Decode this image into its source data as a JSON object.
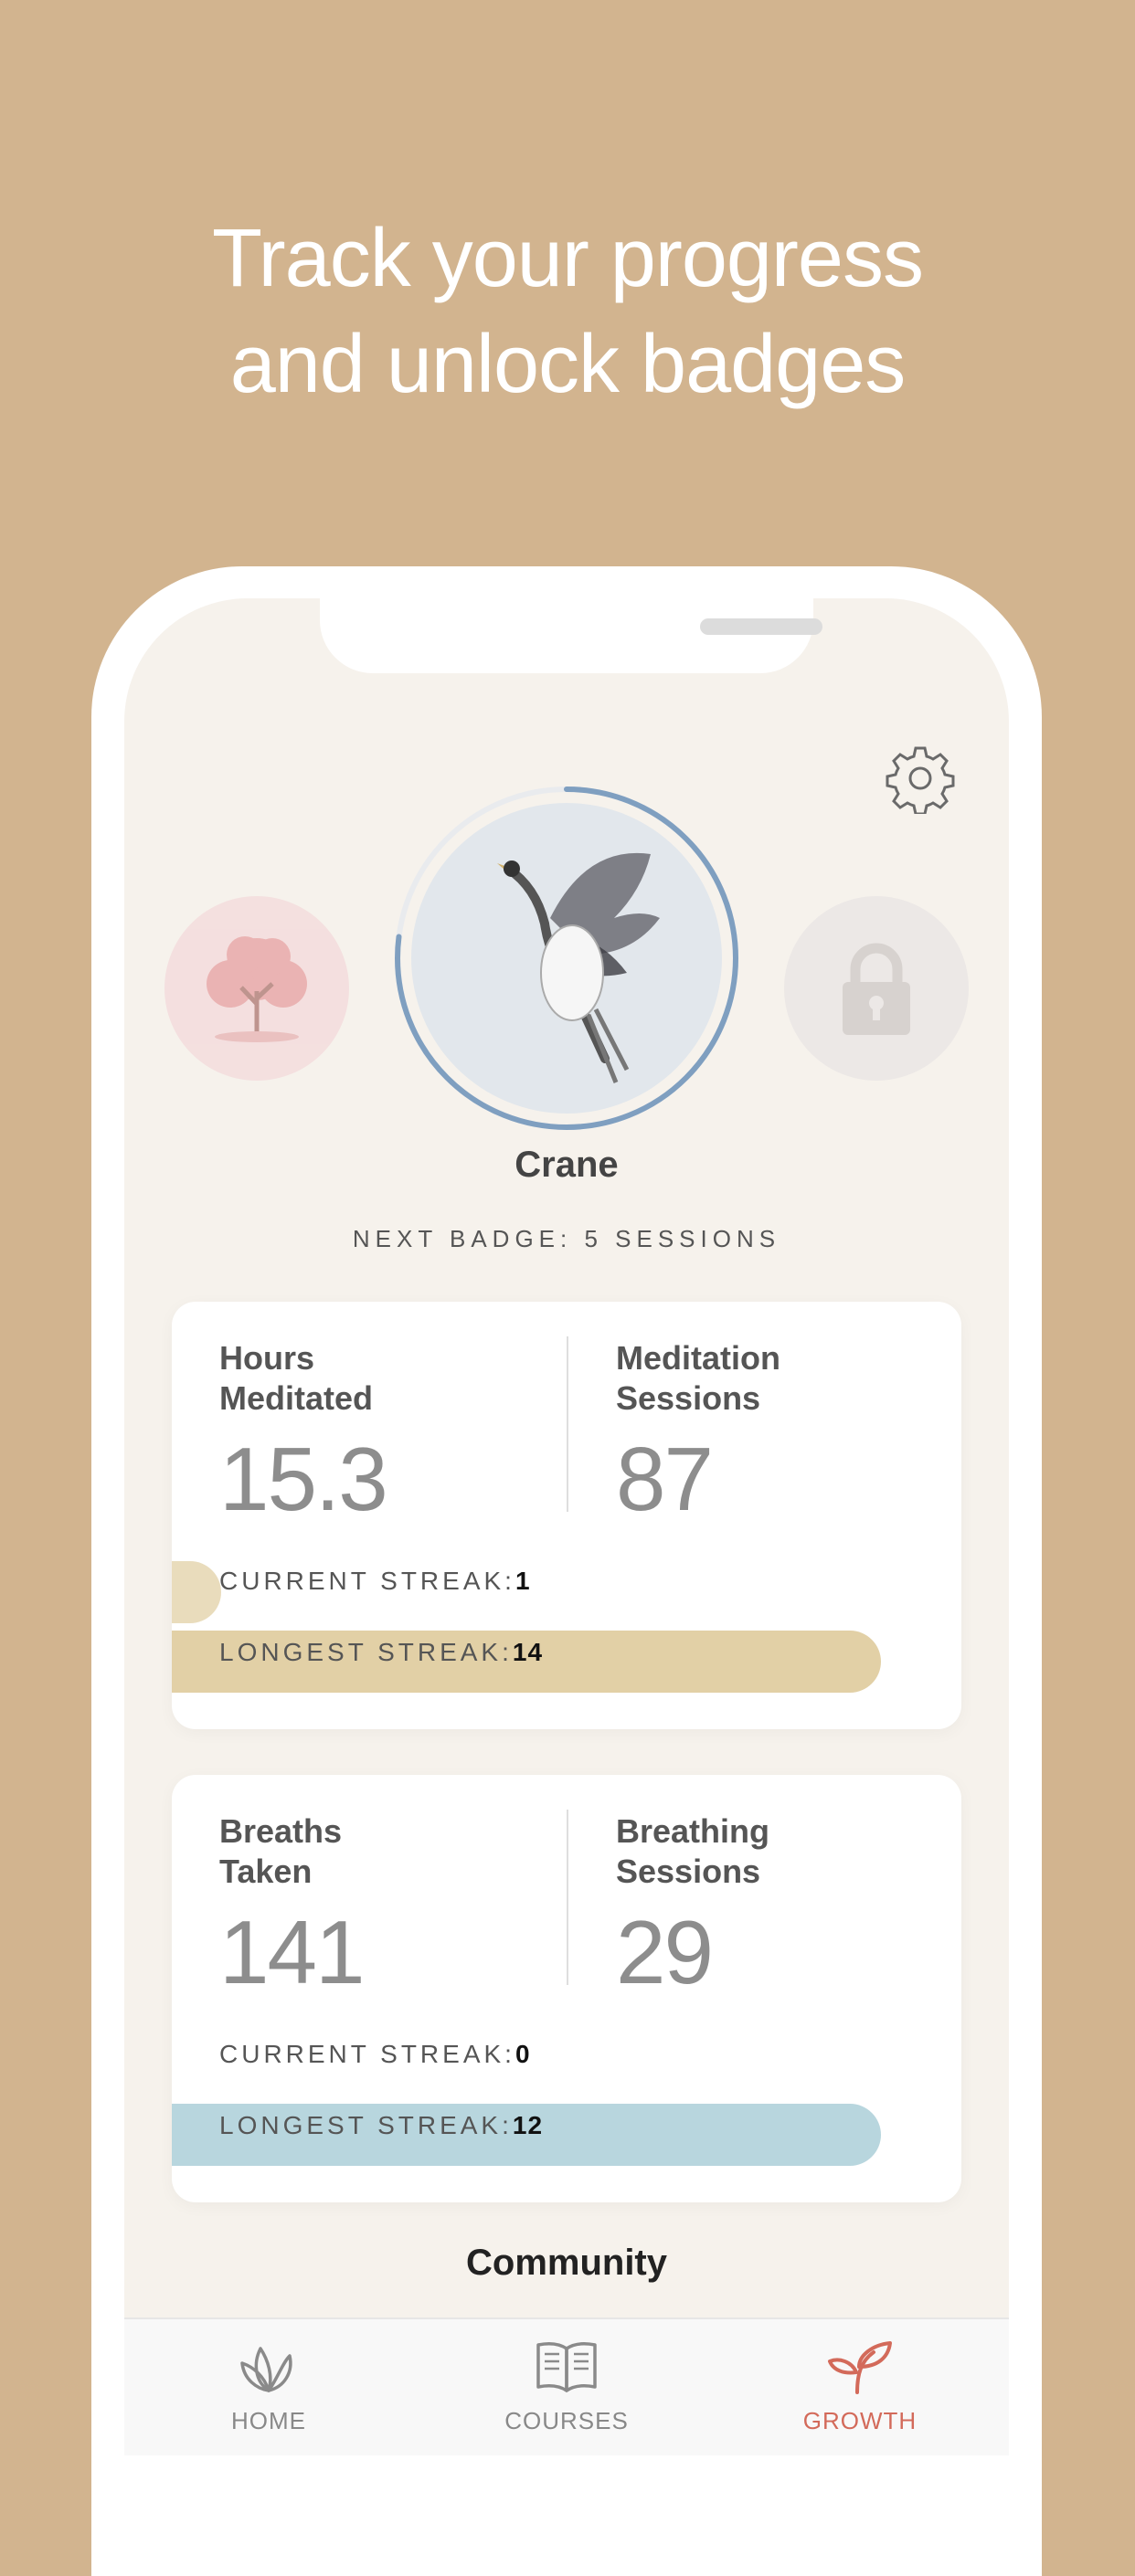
{
  "headline": {
    "line1": "Track your progress",
    "line2": "and unlock badges"
  },
  "badges": {
    "left_icon": "tree-icon",
    "center_icon": "crane-icon",
    "right_icon": "lock-icon",
    "current_name": "Crane",
    "next_badge_text": "NEXT BADGE: 5 SESSIONS",
    "progress_fraction": 0.77,
    "progress_color": "#7f9fc0"
  },
  "meditation_card": {
    "left_label_line1": "Hours",
    "left_label_line2": "Meditated",
    "left_value": "15.3",
    "right_label_line1": "Meditation",
    "right_label_line2": "Sessions",
    "right_value": "87",
    "current_streak_label": "CURRENT STREAK:",
    "current_streak_value": "1",
    "longest_streak_label": "LONGEST STREAK:",
    "longest_streak_value": "14",
    "bar_color": "#e2d0a6",
    "current_streak_fill": 0.07
  },
  "breathing_card": {
    "left_label_line1": "Breaths",
    "left_label_line2": "Taken",
    "left_value": "141",
    "right_label_line1": "Breathing",
    "right_label_line2": "Sessions",
    "right_value": "29",
    "current_streak_label": "CURRENT STREAK:",
    "current_streak_value": "0",
    "longest_streak_label": "LONGEST STREAK:",
    "longest_streak_value": "12",
    "bar_color": "#b8d6de"
  },
  "community_title": "Community",
  "tabbar": {
    "items": [
      {
        "label": "HOME",
        "icon": "lotus-icon"
      },
      {
        "label": "COURSES",
        "icon": "book-icon"
      },
      {
        "label": "GROWTH",
        "icon": "sprout-icon",
        "active": true
      }
    ],
    "active_color": "#d36a5a"
  },
  "settings_icon": "gear-icon"
}
